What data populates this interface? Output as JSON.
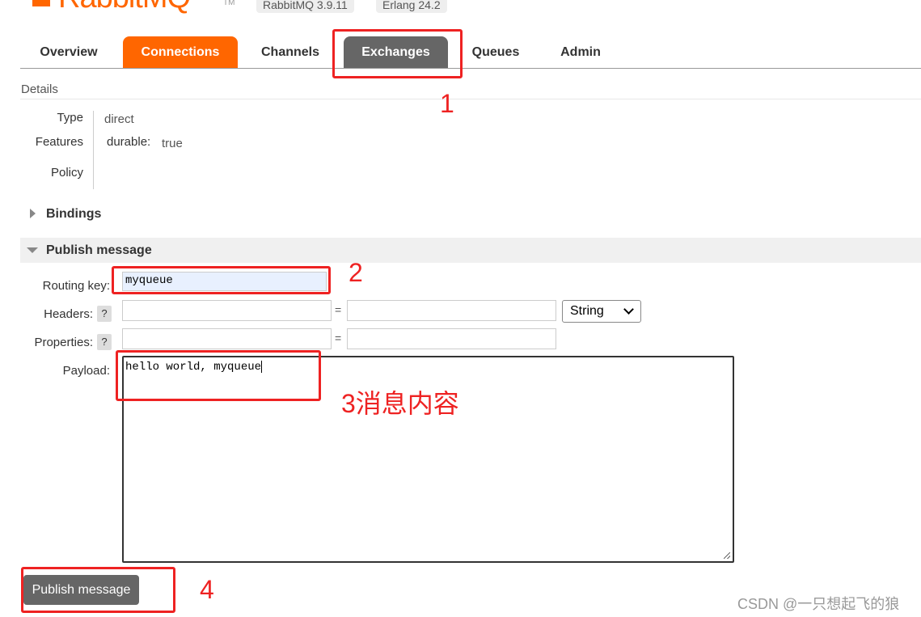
{
  "header": {
    "logo_text": "RabbitMQ",
    "logo_tm": "TM",
    "version_badge": "RabbitMQ 3.9.11",
    "erlang_badge": "Erlang 24.2"
  },
  "tabs": [
    {
      "label": "Overview"
    },
    {
      "label": "Connections"
    },
    {
      "label": "Channels"
    },
    {
      "label": "Exchanges"
    },
    {
      "label": "Queues"
    },
    {
      "label": "Admin"
    }
  ],
  "details": {
    "title": "Details",
    "type_label": "Type",
    "type_value": "direct",
    "features_label": "Features",
    "durable_key": "durable:",
    "durable_value": "true",
    "policy_label": "Policy"
  },
  "bindings": {
    "label": "Bindings"
  },
  "publish": {
    "section_label": "Publish message",
    "routing_key_label": "Routing key:",
    "routing_key_value": "myqueue",
    "headers_label": "Headers:",
    "properties_label": "Properties:",
    "help_mark": "?",
    "equals": "=",
    "type_select": "String",
    "payload_label": "Payload:",
    "payload_value": "hello world, myqueue",
    "button_label": "Publish message"
  },
  "annotations": {
    "n1": "1",
    "n2": "2",
    "n3": "3消息内容",
    "n4": "4",
    "color": "#ee2222"
  },
  "watermark": "CSDN @一只想起飞的狼"
}
